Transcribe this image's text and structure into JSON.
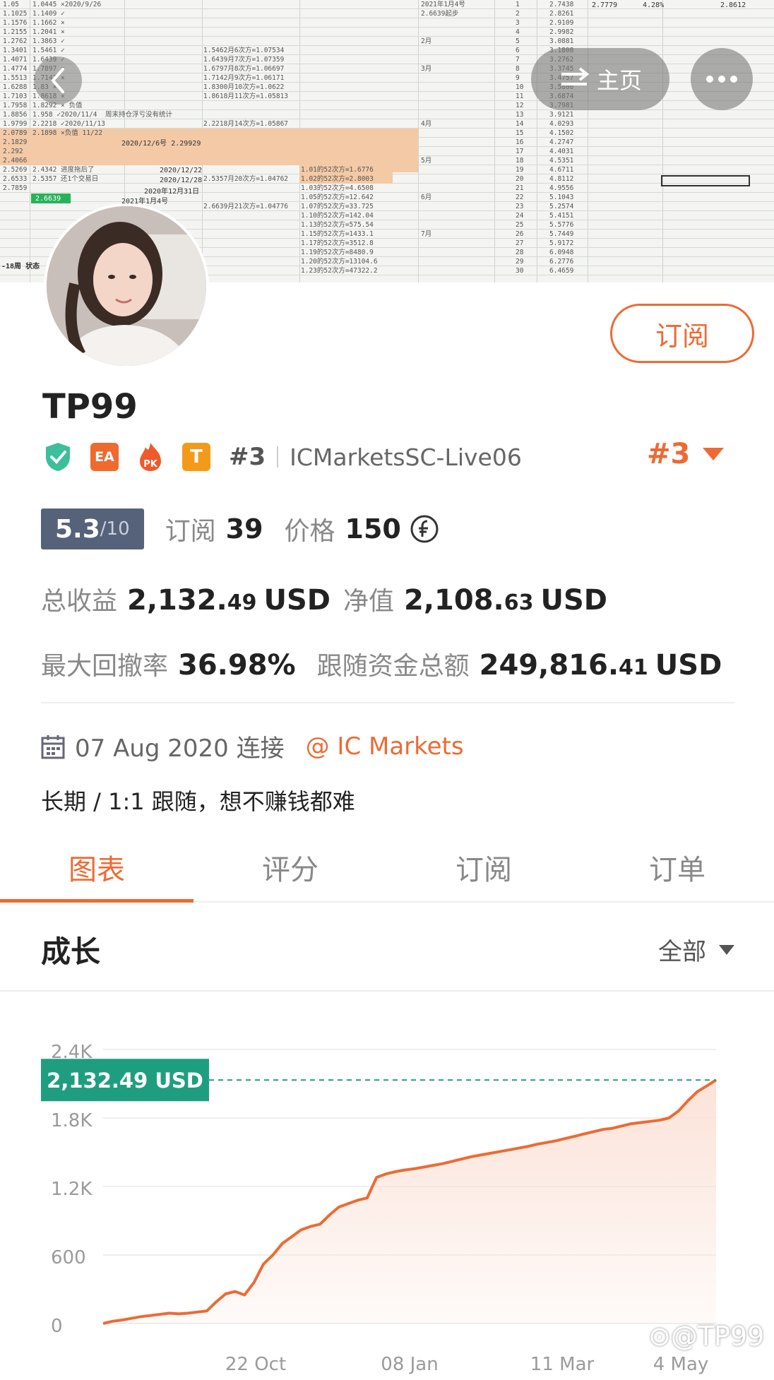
{
  "cover": {
    "col1": [
      "1.05",
      "1.1025",
      "1.1576",
      "1.2155",
      "1.2762",
      "1.3401",
      "1.4071",
      "1.4774",
      "1.5513",
      "1.6288",
      "1.7103",
      "1.7958",
      "1.8856",
      "1.9799",
      "2.0789",
      "2.1829",
      "2.292",
      "2.4066",
      "2.5269",
      "2.6533",
      "2.7859"
    ],
    "col2": [
      "1.0445 ×2020/9/26",
      "1.1409 ✓",
      "1.1662 ×",
      "1.2041 ×",
      "1.3863 ✓",
      "1.5461 ✓",
      "1.6439 ✓",
      "1.7897 ×",
      "1.7142 ×",
      "1.83 ×",
      "1.8618 ×",
      "1.8292 × 负值",
      "1.958 ✓2020/11/4  周末持仓浮亏没有统计",
      "2.2218 ✓2020/11/13",
      "2.1898 ×负值 11/22",
      "",
      "",
      "",
      "2.4342 进度拖后了",
      "2.5357 还1个交易日",
      ""
    ],
    "col3": [
      "",
      "",
      "",
      "",
      "",
      "1.5462月6次方=1.07534",
      "1.6439月7次方=1.07359",
      "1.6797月8次方=1.06697",
      "1.7142月9次方=1.06171",
      "1.8300月10次方=1.0622",
      "1.8618月11次方=1.05813",
      "",
      "",
      "2.2218月14次方=1.05867",
      "",
      "",
      "",
      "",
      "",
      "2.5357月20次方=1.04762",
      "",
      "",
      "2.6639月21次方=1.04776"
    ],
    "col4": [
      "2021年1月4号",
      "2.6639起步",
      "",
      "",
      "2月",
      "",
      "",
      "3月",
      "",
      "",
      "",
      "",
      "",
      "4月",
      "",
      "",
      "",
      "5月",
      "",
      "",
      "",
      "6月",
      "",
      "",
      "",
      "7月",
      "",
      "",
      "",
      ""
    ],
    "col5": [
      "1",
      "2",
      "3",
      "4",
      "5",
      "6",
      "7",
      "8",
      "9",
      "10",
      "11",
      "12",
      "13",
      "14",
      "15",
      "16",
      "17",
      "18",
      "19",
      "20",
      "21",
      "22",
      "23",
      "24",
      "25",
      "26",
      "27",
      "28",
      "29",
      "30"
    ],
    "col6": [
      "2.7438",
      "2.8261",
      "2.9109",
      "2.9982",
      "3.0881",
      "3.1808",
      "3.2762",
      "3.3745",
      "3.4757",
      "3.5800",
      "3.6874",
      "3.7981",
      "3.9121",
      "4.0293",
      "4.1502",
      "4.2747",
      "4.4031",
      "4.5351",
      "4.6711",
      "4.8112",
      "4.9556",
      "5.1043",
      "5.2574",
      "5.4151",
      "5.5776",
      "5.7449",
      "5.9172",
      "6.0948",
      "6.2776",
      "6.4659"
    ],
    "col7": [
      "1.01的52次方=1.6776",
      "1.02的52次方=2.8003",
      "1.03的52次方=4.6508",
      "1.05的52次方=12.642",
      "1.07的52次方=33.725",
      "1.10的52次方=142.04",
      "1.13的52次方=575.54",
      "1.15的52次方=1433.1",
      "1.17的52次方=3512.8",
      "1.19的52次方=8480.9",
      "1.20的52次方=13104.6",
      "1.23的52次方=47322.2"
    ],
    "note_1": "2020/12/6号 2.29929",
    "note_2": "2020/12/22",
    "note_3": "2020/12/28",
    "note_4": "2020年12月31日",
    "note_5": "2021年1月4号",
    "green_cell": "2.6639",
    "row_label": "-18周  状态",
    "top_right": [
      "2.7779",
      "4.28%",
      "2.8612"
    ]
  },
  "nav": {
    "home_label": "主页"
  },
  "profile": {
    "username": "TP99",
    "subscribe_label": "订阅",
    "badge_ea": "EA",
    "badge_pk": "PK",
    "badge_t": "T",
    "rank_inline": "#3",
    "server": "ICMarketsSC-Live06",
    "rank_right": "#3"
  },
  "stats": {
    "score": "5.3",
    "score_denominator": "/10",
    "subscribers_label": "订阅",
    "subscribers_value": "39",
    "price_label": "价格",
    "price_value": "150",
    "total_profit_label": "总收益",
    "total_profit_int": "2,132.",
    "total_profit_dec": "49",
    "total_profit_unit": "USD",
    "equity_label": "净值",
    "equity_int": "2,108.",
    "equity_dec": "63",
    "equity_unit": "USD",
    "max_drawdown_label": "最大回撤率",
    "max_drawdown_value": "36.98%",
    "follow_funds_label": "跟随资金总额",
    "follow_funds_int": "249,816.",
    "follow_funds_dec": "41",
    "follow_funds_unit": "USD"
  },
  "meta": {
    "date": "07 Aug 2020 连接",
    "broker": "@ IC Markets",
    "description": "长期 / 1:1 跟随，想不赚钱都难"
  },
  "tabs": [
    {
      "label": "图表",
      "active": true
    },
    {
      "label": "评分",
      "active": false
    },
    {
      "label": "订阅",
      "active": false
    },
    {
      "label": "订单",
      "active": false
    }
  ],
  "section": {
    "title": "成长",
    "filter_label": "全部"
  },
  "colors": {
    "accent": "#ec6b34",
    "score_badge": "#55627a",
    "current_value": "#1f9e7f",
    "shield": "#3cbf9a"
  },
  "icons": {
    "back": "chevron-left-icon",
    "home": "swap-icon",
    "more": "more-dots-icon",
    "verified": "shield-check-icon",
    "pk": "fire-pk-icon",
    "calendar": "calendar-icon",
    "currency": "currency-coin-icon",
    "dropdown": "caret-down-icon"
  },
  "chart_data": {
    "type": "area",
    "title": "",
    "xlabel": "",
    "ylabel": "",
    "y_ticks": [
      "0",
      "600",
      "1.2K",
      "1.8K",
      "2.4K"
    ],
    "ylim": [
      0,
      2400
    ],
    "x_ticks": [
      "22 Oct",
      "08 Jan",
      "11 Mar",
      "4 May"
    ],
    "current_value_label": "2,132.49 USD",
    "current_value": 2132.49,
    "series": [
      {
        "values": [
          0,
          20,
          30,
          45,
          60,
          70,
          80,
          90,
          85,
          90,
          100,
          110,
          190,
          260,
          280,
          250,
          360,
          520,
          600,
          700,
          760,
          820,
          850,
          870,
          950,
          1020,
          1050,
          1080,
          1100,
          1280,
          1310,
          1330,
          1345,
          1355,
          1370,
          1385,
          1400,
          1420,
          1440,
          1460,
          1475,
          1490,
          1505,
          1520,
          1535,
          1550,
          1570,
          1585,
          1600,
          1620,
          1640,
          1660,
          1680,
          1700,
          1710,
          1730,
          1750,
          1760,
          1770,
          1780,
          1800,
          1860,
          1950,
          2030,
          2080,
          2132.49
        ]
      }
    ],
    "grid": true,
    "fill": "#fbe1d6",
    "line_color": "#ec6b34"
  }
}
